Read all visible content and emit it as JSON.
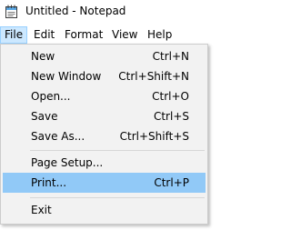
{
  "window": {
    "title": "Untitled - Notepad",
    "icon": "notepad-icon"
  },
  "menubar": {
    "items": [
      "File",
      "Edit",
      "Format",
      "View",
      "Help"
    ],
    "active": "File"
  },
  "file_menu": {
    "items": [
      {
        "label": "New",
        "shortcut": "Ctrl+N"
      },
      {
        "label": "New Window",
        "shortcut": "Ctrl+Shift+N"
      },
      {
        "label": "Open...",
        "shortcut": "Ctrl+O"
      },
      {
        "label": "Save",
        "shortcut": "Ctrl+S"
      },
      {
        "label": "Save As...",
        "shortcut": "Ctrl+Shift+S"
      },
      {
        "label": "Page Setup...",
        "shortcut": ""
      },
      {
        "label": "Print...",
        "shortcut": "Ctrl+P"
      },
      {
        "label": "Exit",
        "shortcut": ""
      }
    ],
    "highlighted": "Print..."
  },
  "colors": {
    "menu_highlight": "#91c9f7",
    "menubar_active_bg": "#cce8ff",
    "menubar_active_border": "#99d1ff",
    "menu_bg": "#f2f2f2"
  }
}
